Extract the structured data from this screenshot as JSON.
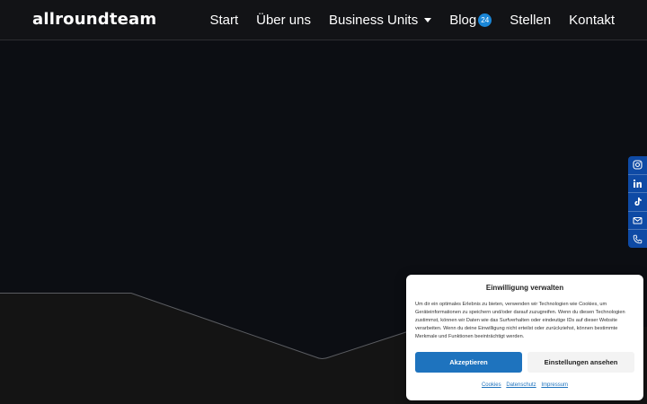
{
  "header": {
    "logo": "allroundteam",
    "nav": [
      {
        "label": "Start"
      },
      {
        "label": "Über uns"
      },
      {
        "label": "Business Units"
      },
      {
        "label": "Blog",
        "badge": "24"
      },
      {
        "label": "Stellen"
      },
      {
        "label": "Kontakt"
      }
    ]
  },
  "social": [
    "instagram-icon",
    "linkedin-icon",
    "tiktok-icon",
    "mail-icon",
    "phone-icon"
  ],
  "colors": {
    "accent": "#1e73be",
    "social_bar": "#0e4aa5",
    "badge": "#1a86d6"
  },
  "cookie": {
    "title": "Einwilligung verwalten",
    "text": "Um dir ein optimales Erlebnis zu bieten, verwenden wir Technologien wie Cookies, um Geräteinformationen zu speichern und/oder darauf zuzugreifen. Wenn du diesen Technologien zustimmst, können wir Daten wie das Surfverhalten oder eindeutige IDs auf dieser Website verarbeiten. Wenn du deine Einwilligung nicht erteilst oder zurückziehst, können bestimmte Merkmale und Funktionen beeinträchtigt werden.",
    "accept_label": "Akzeptieren",
    "settings_label": "Einstellungen ansehen",
    "links": [
      "Cookies",
      "Datenschutz",
      "Impressum"
    ]
  }
}
